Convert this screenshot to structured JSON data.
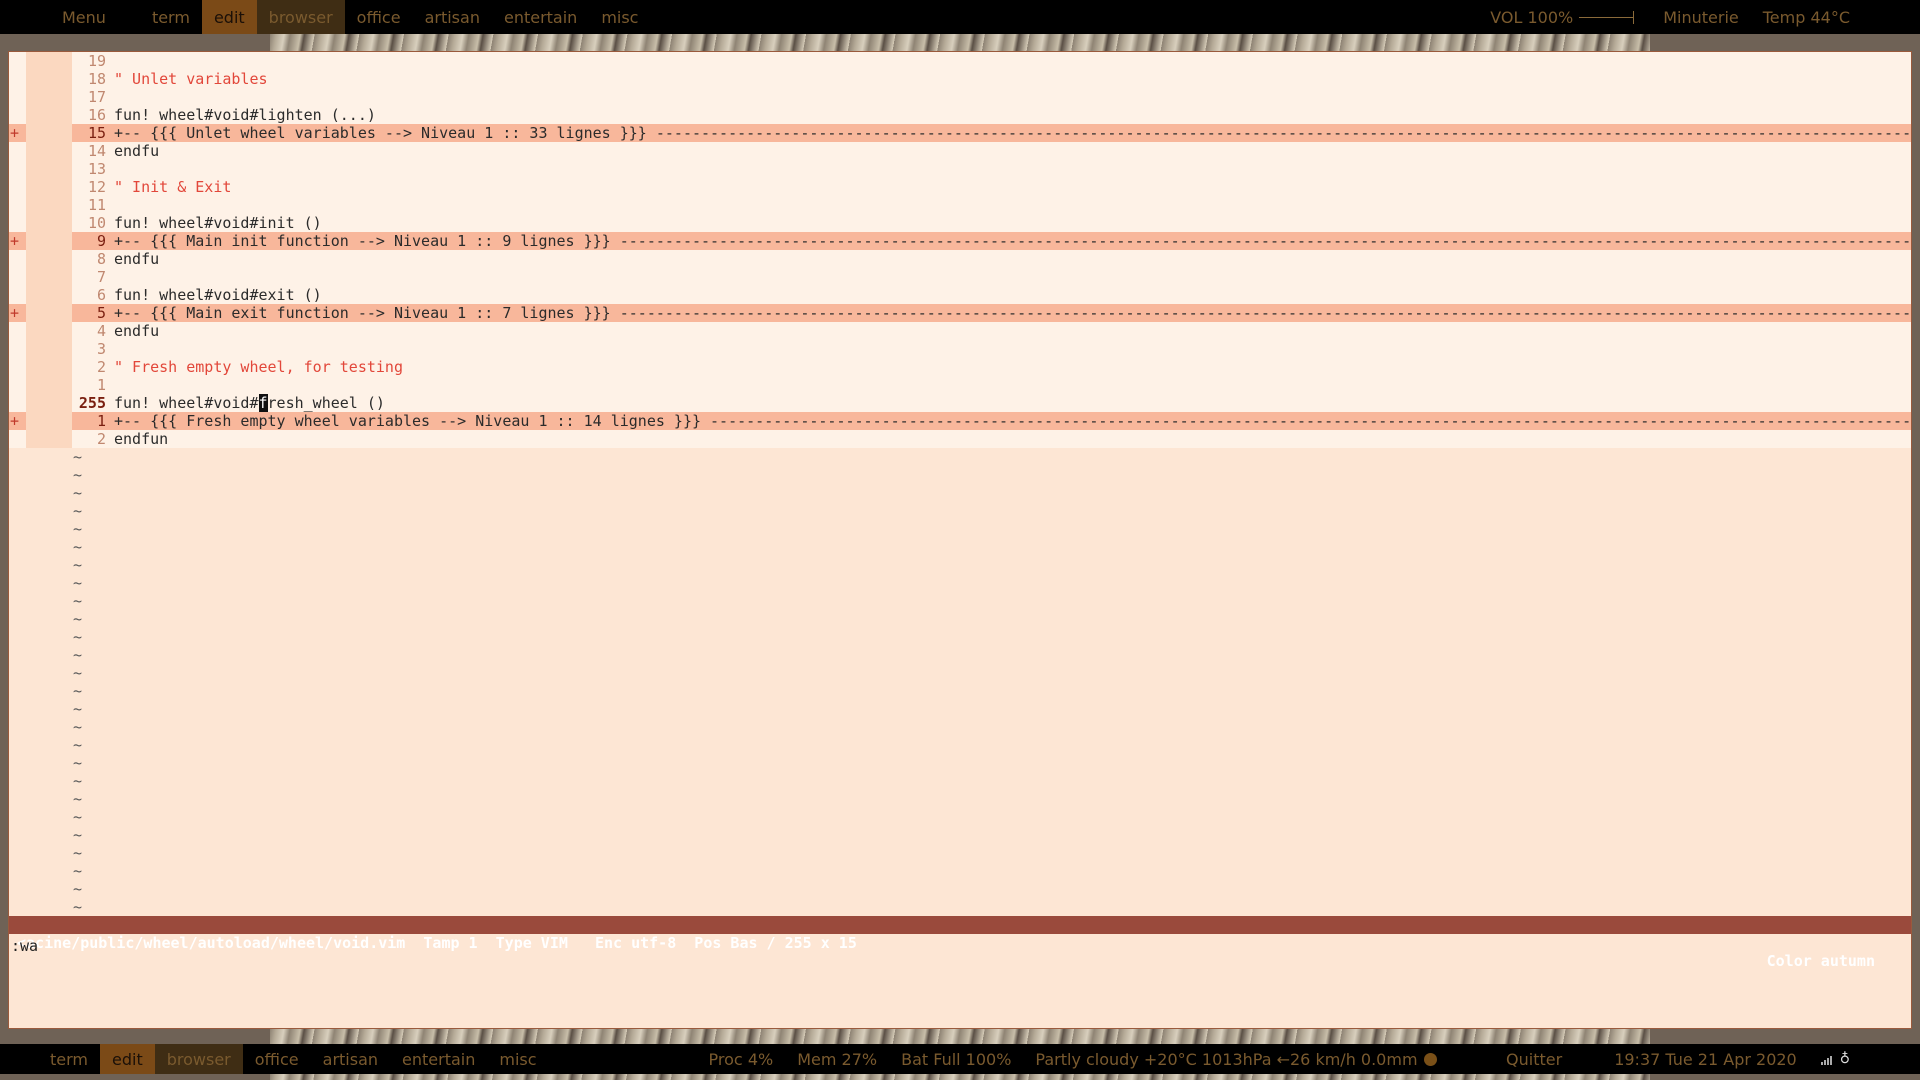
{
  "top_bar": {
    "menu": "Menu",
    "tags": [
      "term",
      "edit",
      "browser",
      "office",
      "artisan",
      "entertain",
      "misc"
    ],
    "volume": "VOL 100%",
    "timer": "Minuterie",
    "temp": "Temp  44°C"
  },
  "bottom_bar": {
    "tags": [
      "term",
      "edit",
      "browser",
      "office",
      "artisan",
      "entertain",
      "misc"
    ],
    "proc": "Proc  4%",
    "mem": "Mem 27%",
    "bat": "Bat Full 100%",
    "weather": "Partly cloudy +20°C 1013hPa ←26 km/h 0.0mm",
    "quit": "Quitter",
    "clock": "19:37  Tue 21 Apr 2020"
  },
  "editor": {
    "lines": [
      {
        "num": "19",
        "text": "",
        "kind": "normal"
      },
      {
        "num": "18",
        "text": "\" Unlet variables",
        "kind": "comment"
      },
      {
        "num": "17",
        "text": "",
        "kind": "normal"
      },
      {
        "num": "16",
        "text": "fun! wheel#void#lighten (...)",
        "kind": "normal"
      },
      {
        "num": "15",
        "text": "+-- {{{ Unlet wheel variables --> Niveau 1 :: 33 lignes }}} ",
        "kind": "fold",
        "sign": "+"
      },
      {
        "num": "14",
        "text": "endfu",
        "kind": "normal"
      },
      {
        "num": "13",
        "text": "",
        "kind": "normal"
      },
      {
        "num": "12",
        "text": "\" Init & Exit",
        "kind": "comment"
      },
      {
        "num": "11",
        "text": "",
        "kind": "normal"
      },
      {
        "num": "10",
        "text": "fun! wheel#void#init ()",
        "kind": "normal"
      },
      {
        "num": "9",
        "text": "+-- {{{ Main init function --> Niveau 1 :: 9 lignes }}} ",
        "kind": "fold",
        "sign": "+"
      },
      {
        "num": "8",
        "text": "endfu",
        "kind": "normal"
      },
      {
        "num": "7",
        "text": "",
        "kind": "normal"
      },
      {
        "num": "6",
        "text": "fun! wheel#void#exit ()",
        "kind": "normal"
      },
      {
        "num": "5",
        "text": "+-- {{{ Main exit function --> Niveau 1 :: 7 lignes }}} ",
        "kind": "fold",
        "sign": "+"
      },
      {
        "num": "4",
        "text": "endfu",
        "kind": "normal"
      },
      {
        "num": "3",
        "text": "",
        "kind": "normal"
      },
      {
        "num": "2",
        "text": "\" Fresh empty wheel, for testing",
        "kind": "comment"
      },
      {
        "num": "1",
        "text": "",
        "kind": "normal"
      },
      {
        "num": "255",
        "text": "fun! wheel#void#fresh_wheel ()",
        "kind": "current",
        "cursor_col": 16
      },
      {
        "num": "1",
        "text": "+-- {{{ Fresh empty wheel variables --> Niveau 1 :: 14 lignes }}} ",
        "kind": "fold",
        "sign": "+"
      },
      {
        "num": "2",
        "text": "endfun",
        "kind": "normal"
      }
    ],
    "tilde_count": 26,
    "tilde_char": "~",
    "status_left": "<acine/public/wheel/autoload/wheel/void.vim  Tamp 1  Type VIM   Enc utf-8  Pos Bas / 255 x 15",
    "status_right": "Color autumn",
    "command": ":wa"
  }
}
